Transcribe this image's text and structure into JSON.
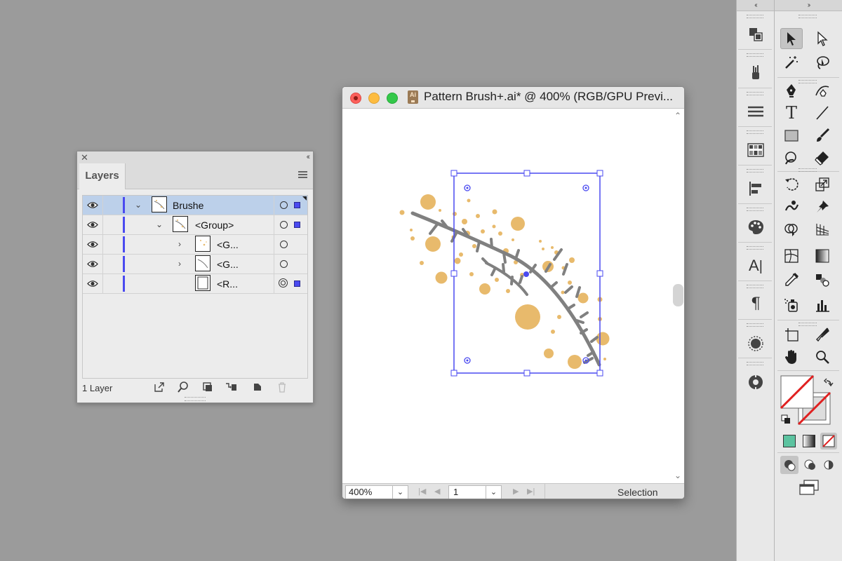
{
  "layers_panel": {
    "tab_label": "Layers",
    "close_glyph": "✕",
    "collapse_glyph": "‹‹",
    "footer_count": "1 Layer",
    "rows": [
      {
        "name": "Brushe",
        "icon": "eye-icon",
        "selected": true
      },
      {
        "name": "<Group>",
        "icon": "eye-icon",
        "selected": false
      },
      {
        "name": "<G...",
        "icon": "eye-icon",
        "selected": false
      },
      {
        "name": "<G...",
        "icon": "eye-icon",
        "selected": false
      },
      {
        "name": "<R...",
        "icon": "eye-icon",
        "selected": false
      }
    ],
    "footer_icons": [
      "export-icon",
      "locate-object-icon",
      "clipping-mask-icon",
      "new-sublayer-icon",
      "new-layer-icon",
      "trash-icon"
    ]
  },
  "document": {
    "title": "Pattern Brush+.ai* @ 400% (RGB/GPU Previ...",
    "app_badge": "Ai",
    "zoom": "400%",
    "page": "1",
    "status": "Selection"
  },
  "dock": {
    "collapse_left": "‹‹",
    "collapse_right": "››",
    "panel_icons": [
      "arrange-icon",
      "brushes-icon",
      "stroke-icon",
      "swatch-grid-icon",
      "align-icon",
      "color-palette-icon",
      "character-icon",
      "paragraph-icon",
      "appearance-icon",
      "recolor-icon"
    ],
    "character_glyph": "A",
    "paragraph_glyph": "¶",
    "type_tool_glyph": "T"
  },
  "colors": {
    "selection": "#4a4af0",
    "dot": "#e8ba6c",
    "branch": "#808080",
    "stroke_none": "#e02020",
    "fill_swatch": "#5cc3a0"
  }
}
